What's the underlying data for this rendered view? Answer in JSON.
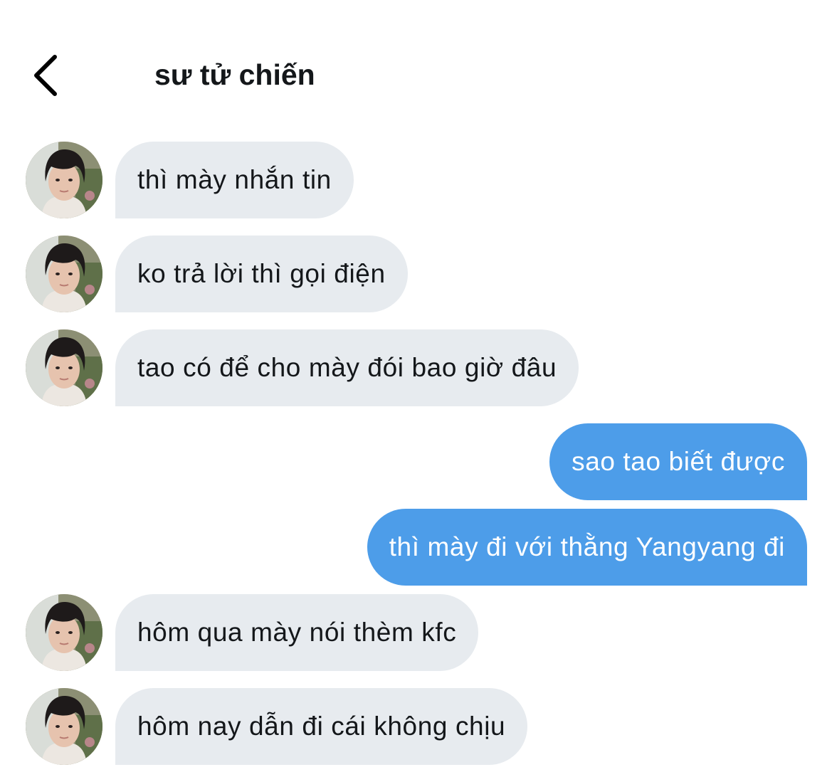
{
  "header": {
    "title": "sư tử chiến",
    "back_icon": "chevron-left-icon"
  },
  "colors": {
    "incoming_bubble": "#e7ebef",
    "outgoing_bubble": "#4d9de9",
    "outgoing_text": "#ffffff",
    "incoming_text": "#14171a"
  },
  "messages": [
    {
      "side": "incoming",
      "text": "thì mày nhắn tin"
    },
    {
      "side": "incoming",
      "text": "ko trả lời thì gọi điện"
    },
    {
      "side": "incoming",
      "text": "tao có để cho mày đói bao giờ đâu"
    },
    {
      "side": "outgoing",
      "text": "sao tao biết được"
    },
    {
      "side": "outgoing",
      "text": "thì mày đi với thằng Yangyang đi"
    },
    {
      "side": "incoming",
      "text": "hôm qua mày nói thèm kfc"
    },
    {
      "side": "incoming",
      "text": "hôm nay dẫn đi cái không chịu"
    }
  ]
}
